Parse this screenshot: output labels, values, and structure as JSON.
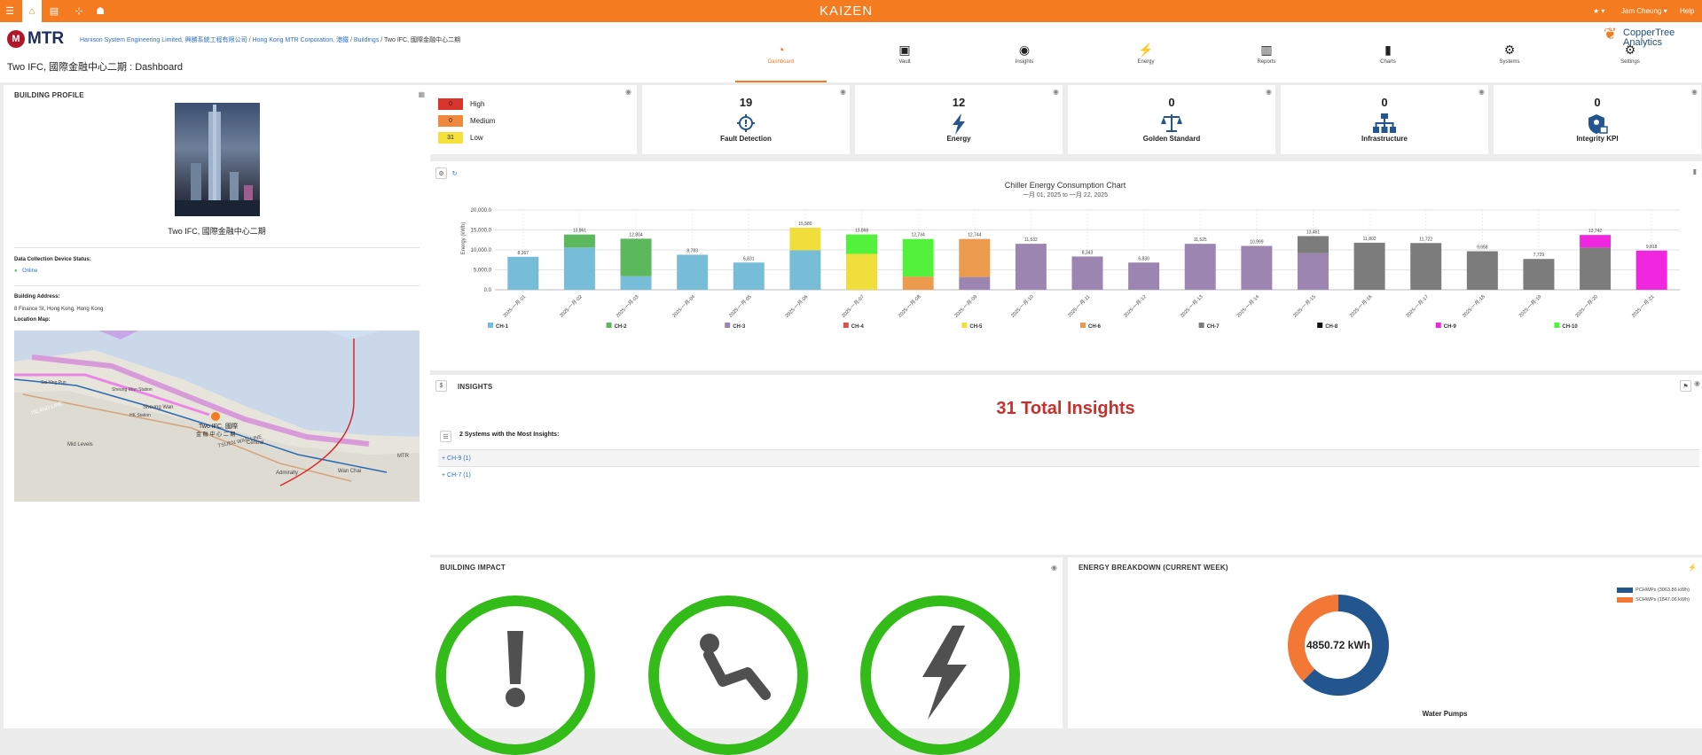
{
  "topbar": {
    "logo": "KAIZEN",
    "user": "Jam Cheung ▾",
    "help": "Help",
    "star": "★ ▾"
  },
  "header": {
    "brand": "MTR",
    "breadcrumb": [
      "Hanison System Engineering Limited, 興勝系統工程有限公司",
      "Hong Kong MTR Corporation, 港鐵",
      "Buildings",
      "Two IFC, 國際金融中心二期"
    ],
    "page_title": "Two IFC, 國際金融中心二期 : Dashboard",
    "partner_line1": "CopperTree",
    "partner_line2": "Analytics"
  },
  "nav": [
    {
      "label": "Dashboard",
      "icon": "dashboard-icon",
      "active": true
    },
    {
      "label": "Vault",
      "icon": "vault-icon"
    },
    {
      "label": "Insights",
      "icon": "insights-icon"
    },
    {
      "label": "Energy",
      "icon": "energy-icon"
    },
    {
      "label": "Reports",
      "icon": "reports-icon"
    },
    {
      "label": "Charts",
      "icon": "charts-icon"
    },
    {
      "label": "Systems",
      "icon": "systems-icon"
    },
    {
      "label": "Settings",
      "icon": "settings-icon"
    }
  ],
  "profile": {
    "title": "BUILDING PROFILE",
    "building_name": "Two IFC, 國際金融中心二期",
    "status_label": "Data Collection Device Status:",
    "status_value": "Online",
    "address_label": "Building Address:",
    "address_value": "8 Finance St, Hong Kong, Hong Kong",
    "map_label": "Location Map:",
    "map_pin_label_1": "Two IFC, 國際",
    "map_pin_label_2": "金 融 中 心 二 期",
    "map_places": [
      "Sheung Wan",
      "Central",
      "Mid Levels",
      "Admiralty",
      "Wan Chai",
      "HK Station",
      "Sai Ying Pun",
      "Sheung Wan Station",
      "ISLAND LINE",
      "TSUEN WAN LINE",
      "MTR"
    ]
  },
  "severity": [
    {
      "count": "0",
      "label": "High",
      "color": "#d9342b"
    },
    {
      "count": "0",
      "label": "Medium",
      "color": "#f0883e"
    },
    {
      "count": "31",
      "label": "Low",
      "color": "#f6e03a"
    }
  ],
  "kpis": [
    {
      "value": "19",
      "label": "Fault Detection",
      "icon": "fault-detection-icon"
    },
    {
      "value": "12",
      "label": "Energy",
      "icon": "energy-bolt-icon"
    },
    {
      "value": "0",
      "label": "Golden Standard",
      "icon": "scales-icon"
    },
    {
      "value": "0",
      "label": "Infrastructure",
      "icon": "hierarchy-icon"
    },
    {
      "value": "0",
      "label": "Integrity KPI",
      "icon": "shield-icon"
    }
  ],
  "chart_data": {
    "type": "bar",
    "stacked": true,
    "title": "Chiller Energy Consumption Chart",
    "subtitle": "一月 01, 2025  to  一月 22, 2025",
    "ylabel": "Energy (kWh)",
    "ylim": [
      0,
      20000
    ],
    "yticks": [
      "0.0",
      "5,000.0",
      "10,000.0",
      "15,000.0",
      "20,000.0"
    ],
    "grid": true,
    "legend_position": "bottom",
    "categories": [
      "2025-一月-01",
      "2025-一月-02",
      "2025-一月-03",
      "2025-一月-04",
      "2025-一月-05",
      "2025-一月-06",
      "2025-一月-07",
      "2025-一月-08",
      "2025-一月-09",
      "2025-一月-10",
      "2025-一月-11",
      "2025-一月-12",
      "2025-一月-13",
      "2025-一月-14",
      "2025-一月-15",
      "2025-一月-16",
      "2025-一月-17",
      "2025-一月-18",
      "2025-一月-19",
      "2025-一月-20",
      "2025-一月-21"
    ],
    "totals": [
      "8,267",
      "13,861",
      "12,804",
      "8,783",
      "6,831",
      "15,580",
      "13,868",
      "12,734",
      "12,744",
      "11,532",
      "8,343",
      "6,830",
      "11,525",
      "10,999",
      "13,461",
      "11,802",
      "11,722",
      "9,658",
      "7,729",
      "13,742",
      "9,818"
    ],
    "series": [
      {
        "name": "CH-1",
        "color": "#78bdd8",
        "values": [
          8267,
          10600,
          3400,
          8783,
          6831,
          9900,
          0,
          0,
          0,
          0,
          0,
          0,
          0,
          0,
          0,
          0,
          0,
          0,
          0,
          0,
          0
        ]
      },
      {
        "name": "CH-2",
        "color": "#5cb85c",
        "values": [
          0,
          3261,
          9404,
          0,
          0,
          0,
          0,
          0,
          0,
          0,
          0,
          0,
          0,
          0,
          0,
          0,
          0,
          0,
          0,
          0,
          0
        ]
      },
      {
        "name": "CH-3",
        "color": "#9d85b2",
        "values": [
          0,
          0,
          0,
          0,
          0,
          0,
          0,
          0,
          3200,
          11532,
          8343,
          6830,
          11525,
          10999,
          9200,
          0,
          0,
          0,
          0,
          0,
          0
        ]
      },
      {
        "name": "CH-4",
        "color": "#d9534f",
        "values": [
          0,
          0,
          0,
          0,
          0,
          0,
          0,
          0,
          0,
          0,
          0,
          0,
          0,
          0,
          0,
          0,
          0,
          0,
          0,
          0,
          0
        ]
      },
      {
        "name": "CH-5",
        "color": "#f0de3c",
        "values": [
          0,
          0,
          0,
          0,
          0,
          5680,
          9000,
          0,
          0,
          0,
          0,
          0,
          0,
          0,
          0,
          0,
          0,
          0,
          0,
          0,
          0
        ]
      },
      {
        "name": "CH-6",
        "color": "#ec9a4e",
        "values": [
          0,
          0,
          0,
          0,
          0,
          0,
          0,
          3300,
          9544,
          0,
          0,
          0,
          0,
          0,
          0,
          0,
          0,
          0,
          0,
          0,
          0
        ]
      },
      {
        "name": "CH-7",
        "color": "#7c7c7c",
        "values": [
          0,
          0,
          0,
          0,
          0,
          0,
          0,
          0,
          0,
          0,
          0,
          0,
          0,
          0,
          4261,
          11802,
          11722,
          9658,
          7729,
          10600,
          0
        ]
      },
      {
        "name": "CH-8",
        "color": "#111111",
        "values": [
          0,
          0,
          0,
          0,
          0,
          0,
          0,
          0,
          0,
          0,
          0,
          0,
          0,
          0,
          0,
          0,
          0,
          0,
          0,
          0,
          0
        ]
      },
      {
        "name": "CH-9",
        "color": "#f127e0",
        "values": [
          0,
          0,
          0,
          0,
          0,
          0,
          0,
          0,
          0,
          0,
          0,
          0,
          0,
          0,
          0,
          0,
          0,
          0,
          0,
          3142,
          9818
        ]
      },
      {
        "name": "CH-10",
        "color": "#52f23c",
        "values": [
          0,
          0,
          0,
          0,
          0,
          0,
          4868,
          9434,
          0,
          0,
          0,
          0,
          0,
          0,
          0,
          0,
          0,
          0,
          0,
          0,
          0
        ]
      }
    ]
  },
  "insights": {
    "title": "INSIGHTS",
    "total": "31 Total Insights",
    "systems_heading": "2 Systems with the Most Insights:",
    "rows": [
      "+ CH-9 (1)",
      "+ CH-7 (1)"
    ],
    "counter_icon": "$"
  },
  "impact": {
    "title": "BUILDING IMPACT",
    "circles": [
      "alert-icon",
      "comfort-icon",
      "lightning-icon"
    ]
  },
  "energy": {
    "title": "ENERGY BREAKDOWN (CURRENT WEEK)",
    "center": "4850.72 kWh",
    "caption": "Water Pumps",
    "legend": [
      {
        "label": "PCHWPs (3063.86 kWh)",
        "color": "#23558f",
        "value": 3063.86
      },
      {
        "label": "SCHWPs (1847.06 kWh)",
        "color": "#f37735",
        "value": 1847.06
      }
    ]
  }
}
